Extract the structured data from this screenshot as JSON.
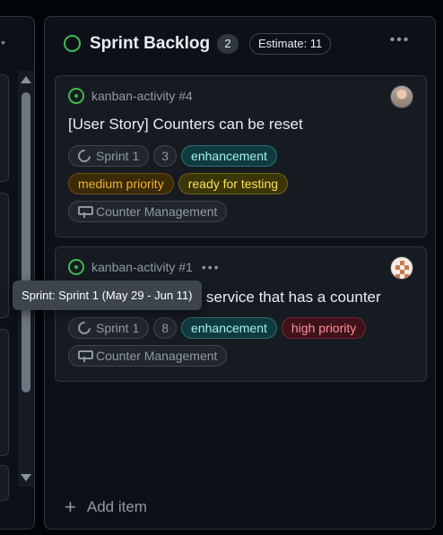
{
  "left_column": {
    "menu_icon": "kebab-horizontal-icon"
  },
  "column": {
    "title": "Sprint Backlog",
    "count": "2",
    "estimate": "Estimate: 11",
    "status_color": "#3fb950",
    "menu_icon": "kebab-horizontal-icon"
  },
  "cards": [
    {
      "issue_ref": "kanban-activity #4",
      "title": "[User Story] Counters can be reset",
      "sprint": "Sprint 1",
      "estimate": "3",
      "labels": [
        "enhancement",
        "medium priority",
        "ready for testing"
      ],
      "milestone": "Counter Management"
    },
    {
      "issue_ref": "kanban-activity #1",
      "more": "•••",
      "title": "[User Story] Need a service that has a counter",
      "sprint": "Sprint 1",
      "estimate": "8",
      "labels": [
        "enhancement",
        "high priority"
      ],
      "milestone": "Counter Management"
    }
  ],
  "tooltip": "Sprint: Sprint 1 (May 29 - Jun 11)",
  "add_item": "Add item",
  "colors": {
    "enhancement": "#a5f1ee",
    "medium_priority": "#f0b232",
    "ready_for_testing": "#f5e35a",
    "high_priority": "#ff8f9a",
    "open_status": "#3fb950"
  }
}
